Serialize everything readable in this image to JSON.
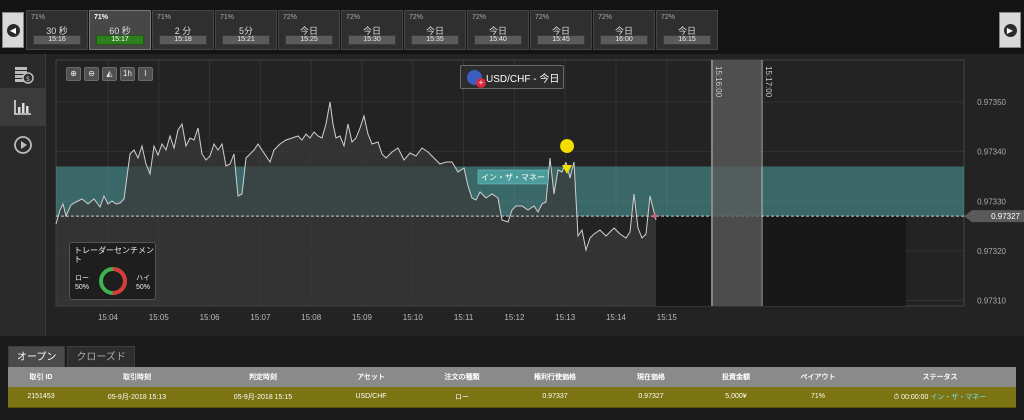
{
  "expiry_tabs": [
    {
      "pct": "71%",
      "duration": "30 秒",
      "time": "15:16",
      "active": false
    },
    {
      "pct": "71%",
      "duration": "60 秒",
      "time": "15:17",
      "active": true
    },
    {
      "pct": "71%",
      "duration": "2 分",
      "time": "15:18",
      "active": false
    },
    {
      "pct": "71%",
      "duration": "5分",
      "time": "15:21",
      "active": false
    },
    {
      "pct": "72%",
      "duration": "今日",
      "time": "15:25",
      "active": false
    },
    {
      "pct": "72%",
      "duration": "今日",
      "time": "15:30",
      "active": false
    },
    {
      "pct": "72%",
      "duration": "今日",
      "time": "15:35",
      "active": false
    },
    {
      "pct": "72%",
      "duration": "今日",
      "time": "15:40",
      "active": false
    },
    {
      "pct": "72%",
      "duration": "今日",
      "time": "15:45",
      "active": false
    },
    {
      "pct": "72%",
      "duration": "今日",
      "time": "16:00",
      "active": false
    },
    {
      "pct": "72%",
      "duration": "今日",
      "time": "16:15",
      "active": false
    }
  ],
  "sidebar": {
    "items": [
      "coins-icon",
      "bar-chart-icon",
      "play-icon"
    ],
    "active_index": 1
  },
  "toolbar": {
    "zoom_in": "⊕",
    "zoom_out": "⊖",
    "area_chart": "◭",
    "timeframe": "1h",
    "line_chart": "⌇"
  },
  "asset": {
    "label": "USD/CHF - 今日"
  },
  "chart": {
    "y_ticks": [
      {
        "value": 0.9735,
        "label": "0.97350"
      },
      {
        "value": 0.9734,
        "label": "0.97340"
      },
      {
        "value": 0.9733,
        "label": "0.97330"
      },
      {
        "value": 0.9732,
        "label": "0.97320"
      },
      {
        "value": 0.9731,
        "label": "0.97310"
      }
    ],
    "x_ticks": [
      "15:04",
      "15:05",
      "15:06",
      "15:07",
      "15:08",
      "15:09",
      "15:10",
      "15:11",
      "15:12",
      "15:13",
      "15:14",
      "15:15"
    ],
    "expiry_labels": [
      "15:16:00",
      "15:17:00"
    ],
    "current_price": "0.97327",
    "zone_label": "イン・ザ・マネー",
    "trade_marker": "chevron-down-icon",
    "colors": {
      "line": "#d0d0d0",
      "zone": "#4fa3a3",
      "marker": "#f4dd00",
      "expiry_band": "#5a5a5a"
    }
  },
  "sentiment": {
    "title": "トレーダーセンチメント",
    "low_label": "ロー",
    "low_pct": "50%",
    "high_label": "ハイ",
    "high_pct": "50%",
    "low_fraction": 0.5,
    "colors": {
      "low": "#d93a3a",
      "high": "#3fb34f"
    }
  },
  "positions": {
    "tabs": [
      "オープン",
      "クローズド"
    ],
    "active_tab": 0,
    "columns": [
      "取引 ID",
      "取引時刻",
      "判定時刻",
      "アセット",
      "注文の種類",
      "権利行使価格",
      "現在価格",
      "投資金額",
      "ペイアウト",
      "ステータス"
    ],
    "rows": [
      {
        "id": "2151453",
        "trade_time": "05-9月-2018 15:13",
        "expiry_time": "05-9月-2018 15:15",
        "asset": "USD/CHF",
        "type": "ロー",
        "strike": "0.97337",
        "current": "0.97327",
        "amount": "5,000¥",
        "payout": "71%",
        "countdown": "00:00:00",
        "status": "イン・ザ・マネー"
      }
    ]
  }
}
